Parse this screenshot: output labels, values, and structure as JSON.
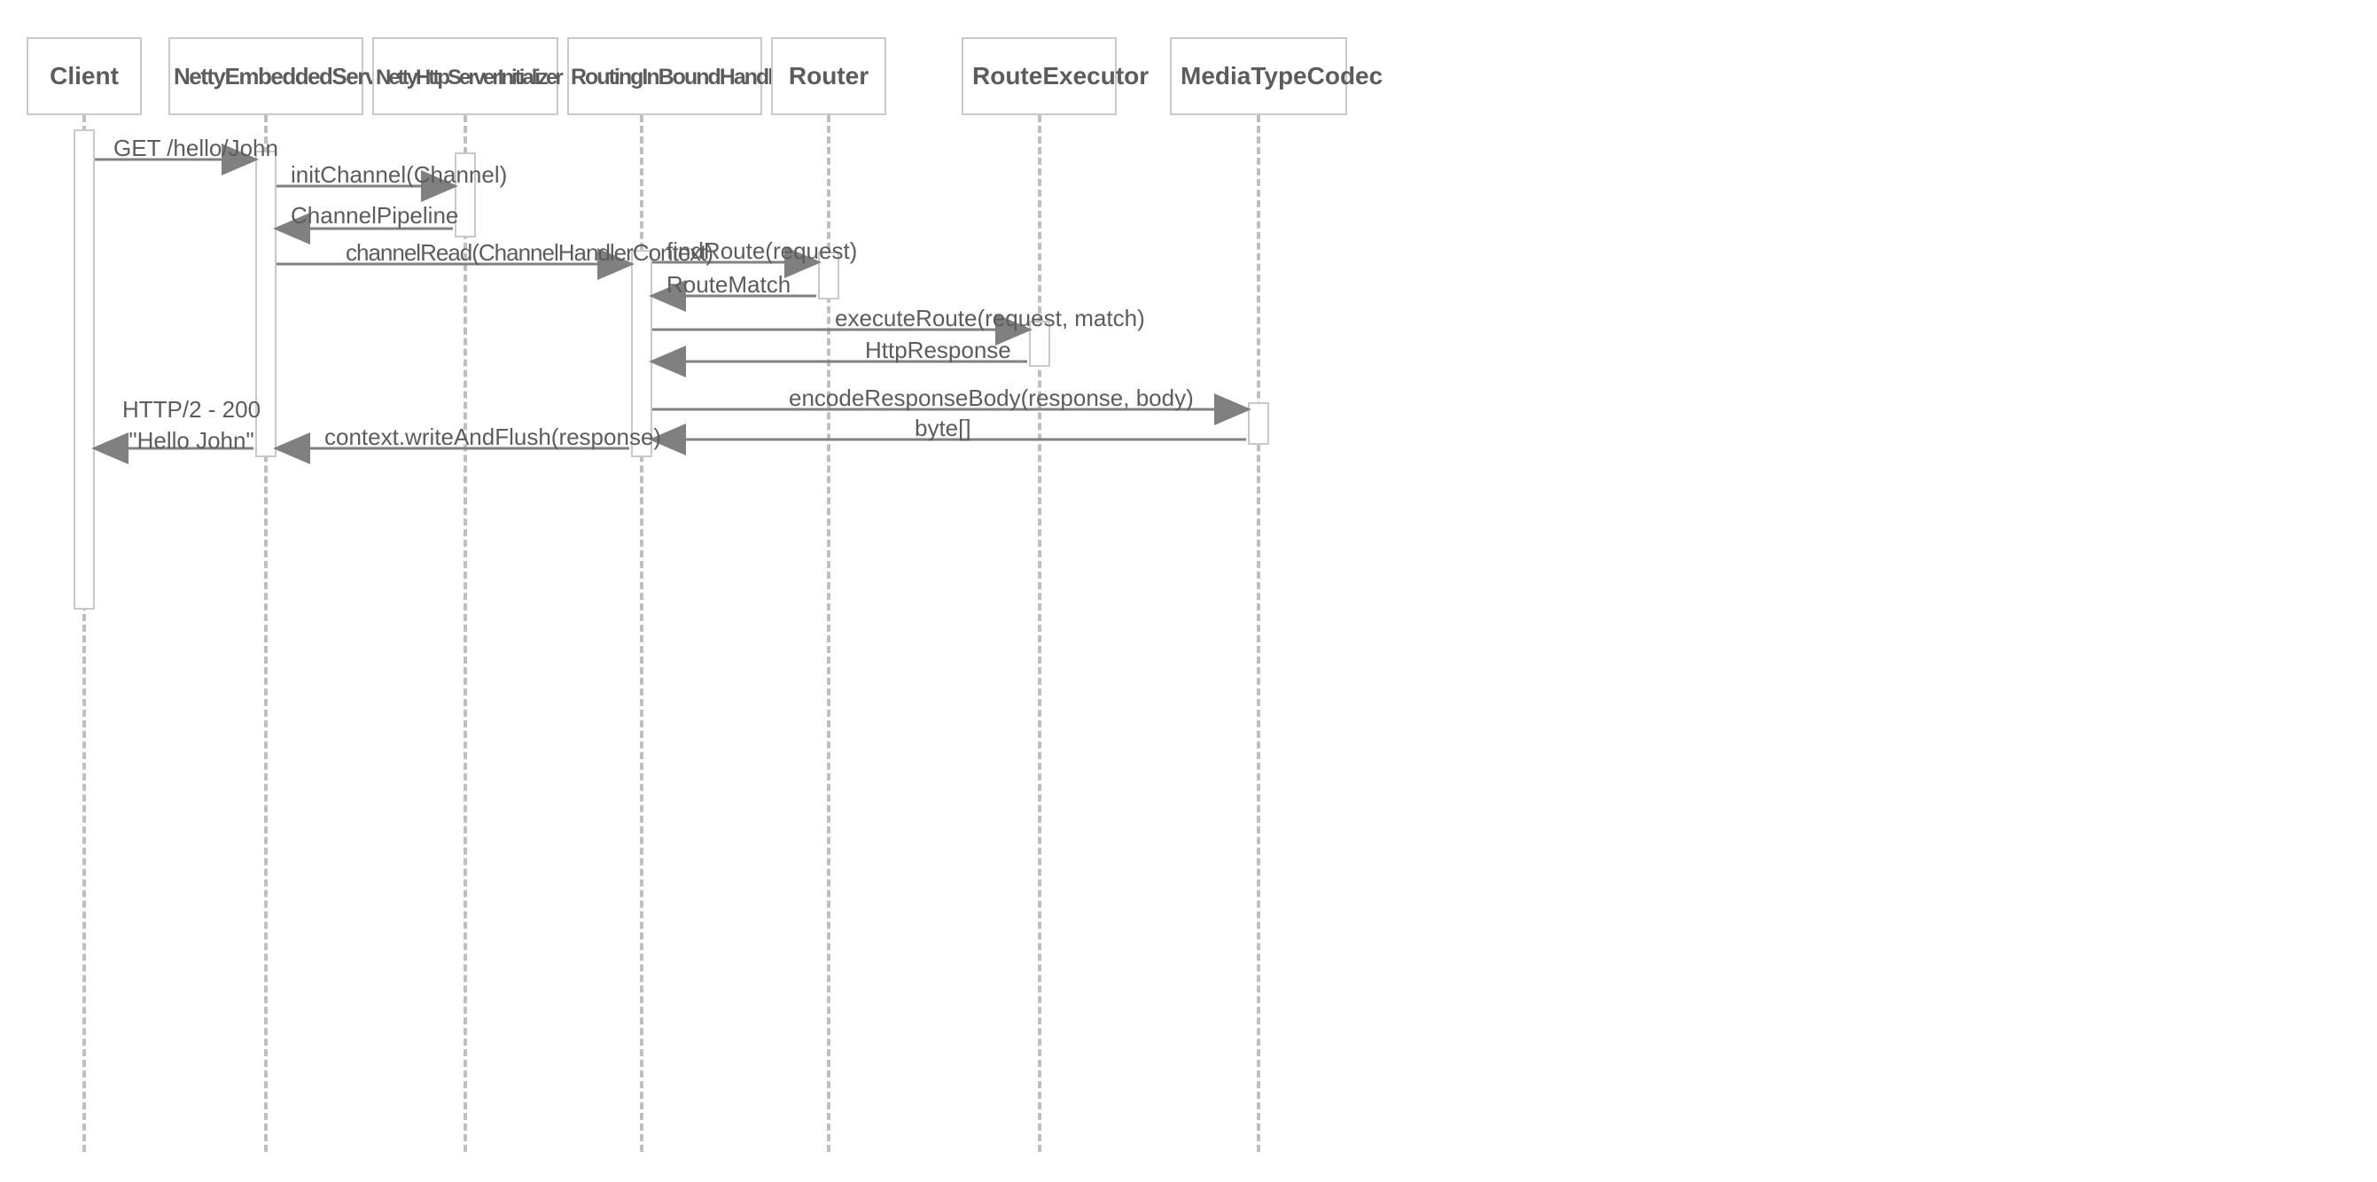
{
  "participants": {
    "client": "Client",
    "nettyEmbeddedServer": "NettyEmbeddedServer",
    "nettyHttpServerInitializer": "NettyHttpServerInitializer",
    "routingInBoundHandler": "RoutingInBoundHandler",
    "router": "Router",
    "routeExecutor": "RouteExecutor",
    "mediaTypeCodec": "MediaTypeCodec"
  },
  "messages": {
    "getHello": "GET /hello/John",
    "initChannel": "initChannel(Channel)",
    "channelPipeline": "ChannelPipeline",
    "channelRead": "channelRead(ChannelHandlerContext)",
    "findRoute": "findRoute(request)",
    "routeMatch": "RouteMatch",
    "executeRoute": "executeRoute(request, match)",
    "httpResponse": "HttpResponse",
    "encodeResponseBody": "encodeResponseBody(response, body)",
    "byteArray": "byte[]",
    "writeAndFlush": "context.writeAndFlush(response)",
    "http2Response1": "HTTP/2 - 200",
    "http2Response2": "\"Hello John\""
  }
}
